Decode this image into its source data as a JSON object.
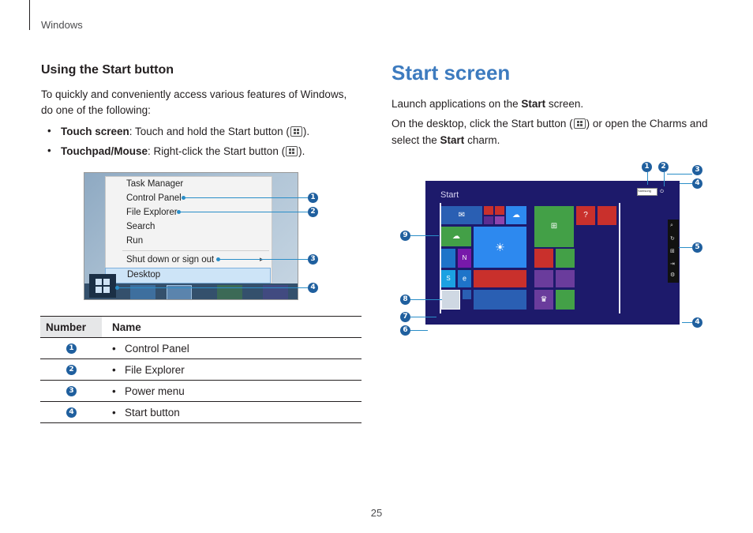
{
  "header": {
    "section": "Windows"
  },
  "left": {
    "heading": "Using the Start button",
    "intro": "To quickly and conveniently access various features of Windows, do one of the following:",
    "bullets": [
      {
        "bold": "Touch screen",
        "pre": ": Touch and hold the Start button (",
        "post": ")."
      },
      {
        "bold": "Touchpad/Mouse",
        "pre": ": Right-click the Start button (",
        "post": ")."
      }
    ],
    "context_menu": {
      "items": [
        "Task Manager",
        "Control Panel",
        "File Explorer",
        "Search",
        "Run"
      ],
      "shutdown": "Shut down or sign out",
      "desktop": "Desktop",
      "callouts": [
        "1",
        "2",
        "3",
        "4"
      ]
    },
    "table": {
      "headers": [
        "Number",
        "Name"
      ],
      "rows": [
        {
          "num": "1",
          "name": "Control Panel"
        },
        {
          "num": "2",
          "name": "File Explorer"
        },
        {
          "num": "3",
          "name": "Power menu"
        },
        {
          "num": "4",
          "name": "Start button"
        }
      ]
    }
  },
  "right": {
    "title": "Start screen",
    "p1": {
      "pre": "Launch applications on the ",
      "bold": "Start",
      "post": " screen."
    },
    "p2": {
      "pre": "On the desktop, click the Start button (",
      "mid": ") or open the Charms and select the ",
      "bold": "Start",
      "post": " charm."
    },
    "start_screen": {
      "title": "Start",
      "account": "Samsung",
      "callouts": [
        "1",
        "2",
        "3",
        "4",
        "5",
        "4",
        "6",
        "7",
        "8",
        "9"
      ],
      "colors": {
        "background": "#1d1a6b",
        "green": "#43a047",
        "red": "#c9302c",
        "blue": "#2d89ef",
        "purple": "#6a3c9c"
      }
    }
  },
  "footer": {
    "page": "25"
  }
}
